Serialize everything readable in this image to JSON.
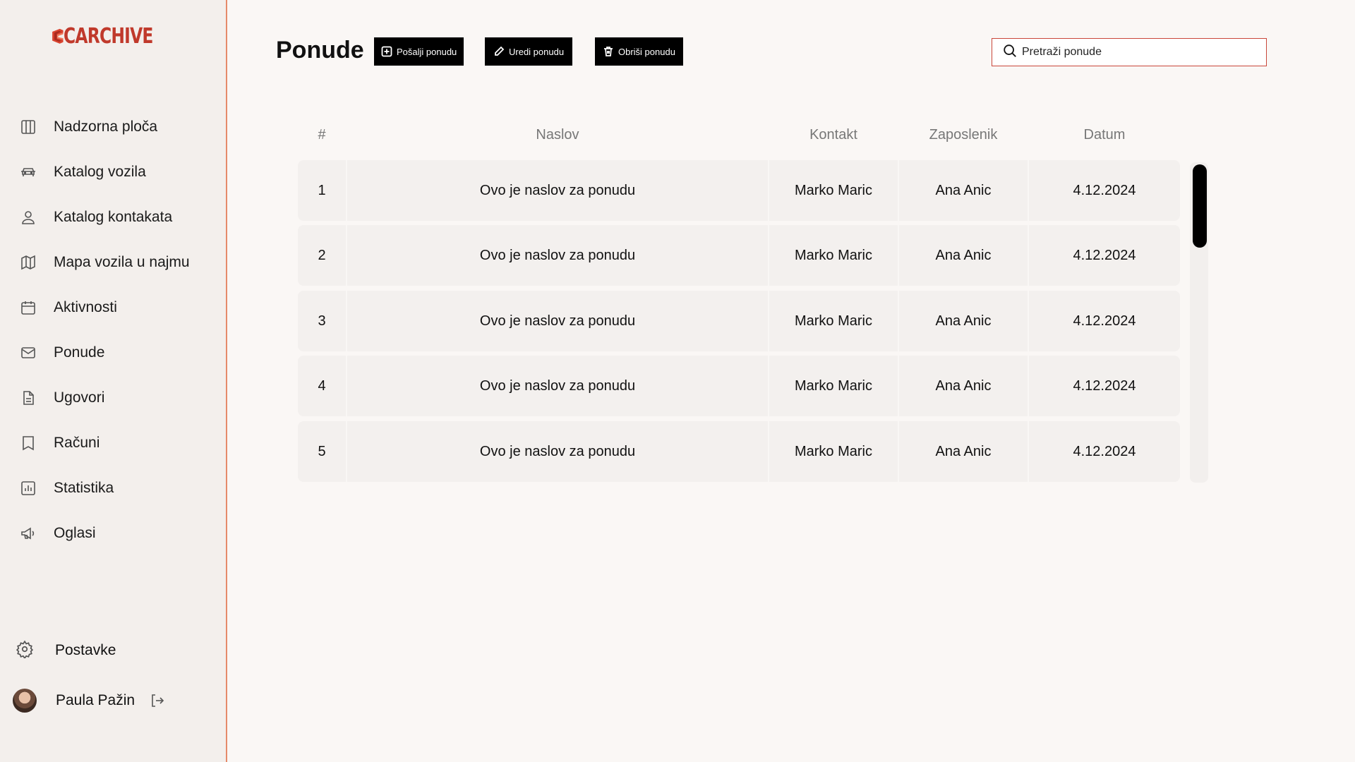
{
  "brand": {
    "name": "CARCHIVE",
    "color": "#c0392b"
  },
  "sidebar": {
    "items": [
      {
        "label": "Nadzorna ploča",
        "icon": "dashboard-icon"
      },
      {
        "label": "Katalog vozila",
        "icon": "car-icon"
      },
      {
        "label": "Katalog kontakata",
        "icon": "user-icon"
      },
      {
        "label": "Mapa vozila u najmu",
        "icon": "map-icon"
      },
      {
        "label": "Aktivnosti",
        "icon": "calendar-icon"
      },
      {
        "label": "Ponude",
        "icon": "mail-icon"
      },
      {
        "label": "Ugovori",
        "icon": "document-icon"
      },
      {
        "label": "Računi",
        "icon": "receipt-icon"
      },
      {
        "label": "Statistika",
        "icon": "chart-icon"
      },
      {
        "label": "Oglasi",
        "icon": "megaphone-icon"
      }
    ],
    "settings": {
      "label": "Postavke",
      "icon": "gear-icon"
    },
    "user": {
      "name": "Paula Pažin",
      "logout_icon": "logout-icon"
    }
  },
  "header": {
    "title": "Ponude",
    "buttons": {
      "send": "Pošalji ponudu",
      "edit": "Uredi ponudu",
      "delete": "Obriši ponudu"
    },
    "search": {
      "placeholder": "Pretraži ponude",
      "value": ""
    }
  },
  "table": {
    "columns": [
      "#",
      "Naslov",
      "Kontakt",
      "Zaposlenik",
      "Datum"
    ],
    "rows": [
      [
        "1",
        "Ovo je naslov za ponudu",
        "Marko Maric",
        "Ana Anic",
        "4.12.2024"
      ],
      [
        "2",
        "Ovo je naslov za ponudu",
        "Marko Maric",
        "Ana Anic",
        "4.12.2024"
      ],
      [
        "3",
        "Ovo je naslov za ponudu",
        "Marko Maric",
        "Ana Anic",
        "4.12.2024"
      ],
      [
        "4",
        "Ovo je naslov za ponudu",
        "Marko Maric",
        "Ana Anic",
        "4.12.2024"
      ],
      [
        "5",
        "Ovo je naslov za ponudu",
        "Marko Maric",
        "Ana Anic",
        "4.12.2024"
      ]
    ]
  },
  "colors": {
    "accent": "#c9463a",
    "sidebar_border": "#e58a6a",
    "background": "#faf7f5",
    "sidebar_bg": "#f3efec",
    "row_bg": "#f3f0ee"
  }
}
